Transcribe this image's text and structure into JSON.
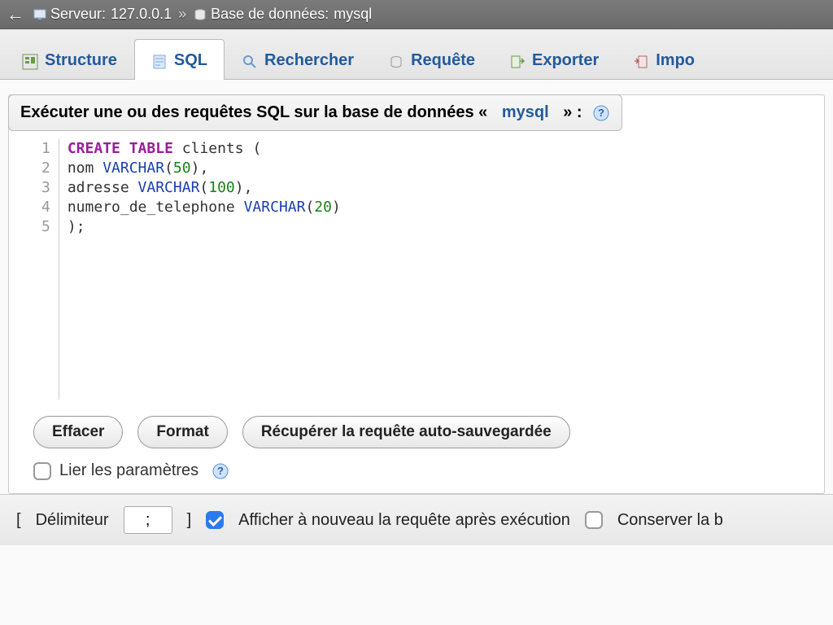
{
  "breadcrumb": {
    "server_prefix": "Serveur:",
    "server_value": "127.0.0.1",
    "separator": "»",
    "db_prefix": "Base de données:",
    "db_value": "mysql"
  },
  "tabs": [
    {
      "label": "Structure"
    },
    {
      "label": "SQL"
    },
    {
      "label": "Rechercher"
    },
    {
      "label": "Requête"
    },
    {
      "label": "Exporter"
    },
    {
      "label": "Impo"
    }
  ],
  "panel": {
    "title_prefix": "Exécuter une ou des requêtes SQL sur la base de données «",
    "db_link": "mysql",
    "title_suffix": "» :"
  },
  "sql": {
    "lines": [
      {
        "n": "1",
        "tokens": [
          [
            "kw",
            "CREATE"
          ],
          [
            "sp",
            " "
          ],
          [
            "kw",
            "TABLE"
          ],
          [
            "sp",
            " "
          ],
          [
            "ident",
            "clients"
          ],
          [
            "sp",
            " "
          ],
          [
            "punc",
            "("
          ]
        ]
      },
      {
        "n": "2",
        "tokens": [
          [
            "ident",
            "nom"
          ],
          [
            "sp",
            " "
          ],
          [
            "type",
            "VARCHAR"
          ],
          [
            "punc",
            "("
          ],
          [
            "num",
            "50"
          ],
          [
            "punc",
            ")"
          ],
          [
            "punc",
            ","
          ]
        ]
      },
      {
        "n": "3",
        "tokens": [
          [
            "ident",
            "adresse"
          ],
          [
            "sp",
            " "
          ],
          [
            "type",
            "VARCHAR"
          ],
          [
            "punc",
            "("
          ],
          [
            "num",
            "100"
          ],
          [
            "punc",
            ")"
          ],
          [
            "punc",
            ","
          ]
        ]
      },
      {
        "n": "4",
        "tokens": [
          [
            "ident",
            "numero_de_telephone"
          ],
          [
            "sp",
            " "
          ],
          [
            "type",
            "VARCHAR"
          ],
          [
            "punc",
            "("
          ],
          [
            "num",
            "20"
          ],
          [
            "punc",
            ")"
          ]
        ]
      },
      {
        "n": "5",
        "tokens": [
          [
            "punc",
            ")"
          ],
          [
            "punc",
            ";"
          ]
        ]
      }
    ]
  },
  "buttons": {
    "clear": "Effacer",
    "format": "Format",
    "restore": "Récupérer la requête auto-sauvegardée"
  },
  "bind": {
    "label": "Lier les paramètres"
  },
  "bottom": {
    "delimiter_label_open": "[",
    "delimiter_label": "Délimiteur",
    "delimiter_value": ";",
    "delimiter_label_close": "]",
    "show_again": "Afficher à nouveau la requête après exécution",
    "keep_box": "Conserver la b"
  }
}
